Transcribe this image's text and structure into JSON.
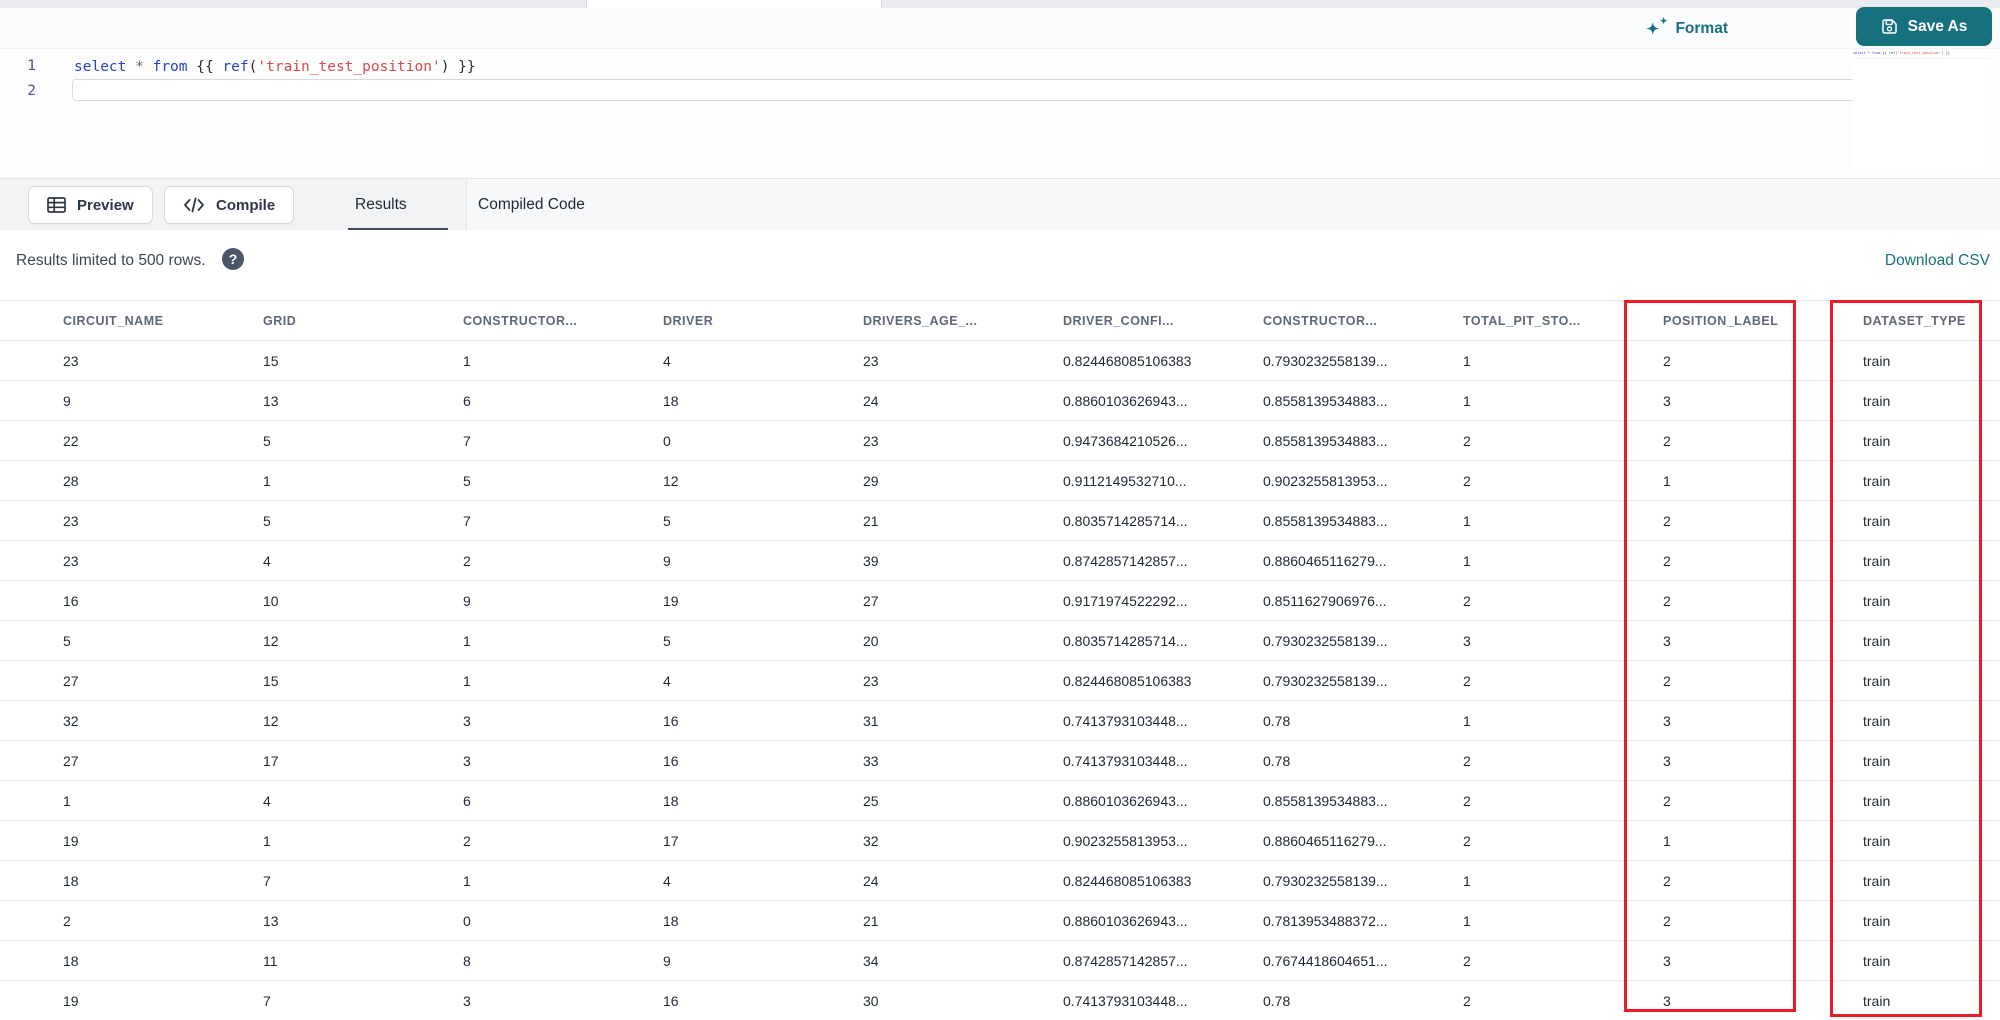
{
  "editor": {
    "line_numbers": [
      "1",
      "2"
    ],
    "tokens": [
      {
        "text": "select",
        "type": "keyword"
      },
      {
        "text": " ",
        "type": "plain"
      },
      {
        "text": "*",
        "type": "operator"
      },
      {
        "text": " ",
        "type": "plain"
      },
      {
        "text": "from",
        "type": "keyword"
      },
      {
        "text": " {{ ",
        "type": "plain"
      },
      {
        "text": "ref",
        "type": "keyword"
      },
      {
        "text": "(",
        "type": "plain"
      },
      {
        "text": "'train_test_position'",
        "type": "string"
      },
      {
        "text": ")",
        "type": "plain"
      },
      {
        "text": " }}",
        "type": "plain"
      }
    ],
    "format_label": "Format",
    "save_as_label": "Save As",
    "sparkle_glyph": "✦"
  },
  "toolbar": {
    "preview_label": "Preview",
    "compile_label": "Compile",
    "tabs": [
      {
        "label": "Results",
        "active": true
      },
      {
        "label": "Compiled Code",
        "active": false
      }
    ]
  },
  "results_bar": {
    "limit_text": "Results limited to 500 rows.",
    "help_glyph": "?",
    "download_label": "Download CSV"
  },
  "table": {
    "columns": [
      "CIRCUIT_NAME",
      "GRID",
      "CONSTRUCTOR...",
      "DRIVER",
      "DRIVERS_AGE_...",
      "DRIVER_CONFI...",
      "CONSTRUCTOR...",
      "TOTAL_PIT_STO...",
      "POSITION_LABEL",
      "DATASET_TYPE"
    ],
    "rows": [
      [
        "23",
        "15",
        "1",
        "4",
        "23",
        "0.824468085106383",
        "0.7930232558139...",
        "1",
        "2",
        "train"
      ],
      [
        "9",
        "13",
        "6",
        "18",
        "24",
        "0.8860103626943...",
        "0.8558139534883...",
        "1",
        "3",
        "train"
      ],
      [
        "22",
        "5",
        "7",
        "0",
        "23",
        "0.9473684210526...",
        "0.8558139534883...",
        "2",
        "2",
        "train"
      ],
      [
        "28",
        "1",
        "5",
        "12",
        "29",
        "0.9112149532710...",
        "0.9023255813953...",
        "2",
        "1",
        "train"
      ],
      [
        "23",
        "5",
        "7",
        "5",
        "21",
        "0.8035714285714...",
        "0.8558139534883...",
        "1",
        "2",
        "train"
      ],
      [
        "23",
        "4",
        "2",
        "9",
        "39",
        "0.8742857142857...",
        "0.8860465116279...",
        "1",
        "2",
        "train"
      ],
      [
        "16",
        "10",
        "9",
        "19",
        "27",
        "0.9171974522292...",
        "0.8511627906976...",
        "2",
        "2",
        "train"
      ],
      [
        "5",
        "12",
        "1",
        "5",
        "20",
        "0.8035714285714...",
        "0.7930232558139...",
        "3",
        "3",
        "train"
      ],
      [
        "27",
        "15",
        "1",
        "4",
        "23",
        "0.824468085106383",
        "0.7930232558139...",
        "2",
        "2",
        "train"
      ],
      [
        "32",
        "12",
        "3",
        "16",
        "31",
        "0.7413793103448...",
        "0.78",
        "1",
        "3",
        "train"
      ],
      [
        "27",
        "17",
        "3",
        "16",
        "33",
        "0.7413793103448...",
        "0.78",
        "2",
        "3",
        "train"
      ],
      [
        "1",
        "4",
        "6",
        "18",
        "25",
        "0.8860103626943...",
        "0.8558139534883...",
        "2",
        "2",
        "train"
      ],
      [
        "19",
        "1",
        "2",
        "17",
        "32",
        "0.9023255813953...",
        "0.8860465116279...",
        "2",
        "1",
        "train"
      ],
      [
        "18",
        "7",
        "1",
        "4",
        "24",
        "0.824468085106383",
        "0.7930232558139...",
        "1",
        "2",
        "train"
      ],
      [
        "2",
        "13",
        "0",
        "18",
        "21",
        "0.8860103626943...",
        "0.7813953488372...",
        "1",
        "2",
        "train"
      ],
      [
        "18",
        "11",
        "8",
        "9",
        "34",
        "0.8742857142857...",
        "0.7674418604651...",
        "2",
        "3",
        "train"
      ],
      [
        "19",
        "7",
        "3",
        "16",
        "30",
        "0.7413793103448...",
        "0.78",
        "2",
        "3",
        "train"
      ]
    ]
  },
  "annotations": {
    "highlight_color": "#ed1c24",
    "highlighted_columns": [
      "POSITION_LABEL",
      "DATASET_TYPE"
    ]
  },
  "colors": {
    "accent_teal": "#16707e",
    "keyword_blue": "#2743c8",
    "string_red": "#d6494d",
    "header_text": "#5d6878",
    "cell_text": "#1e2837"
  }
}
